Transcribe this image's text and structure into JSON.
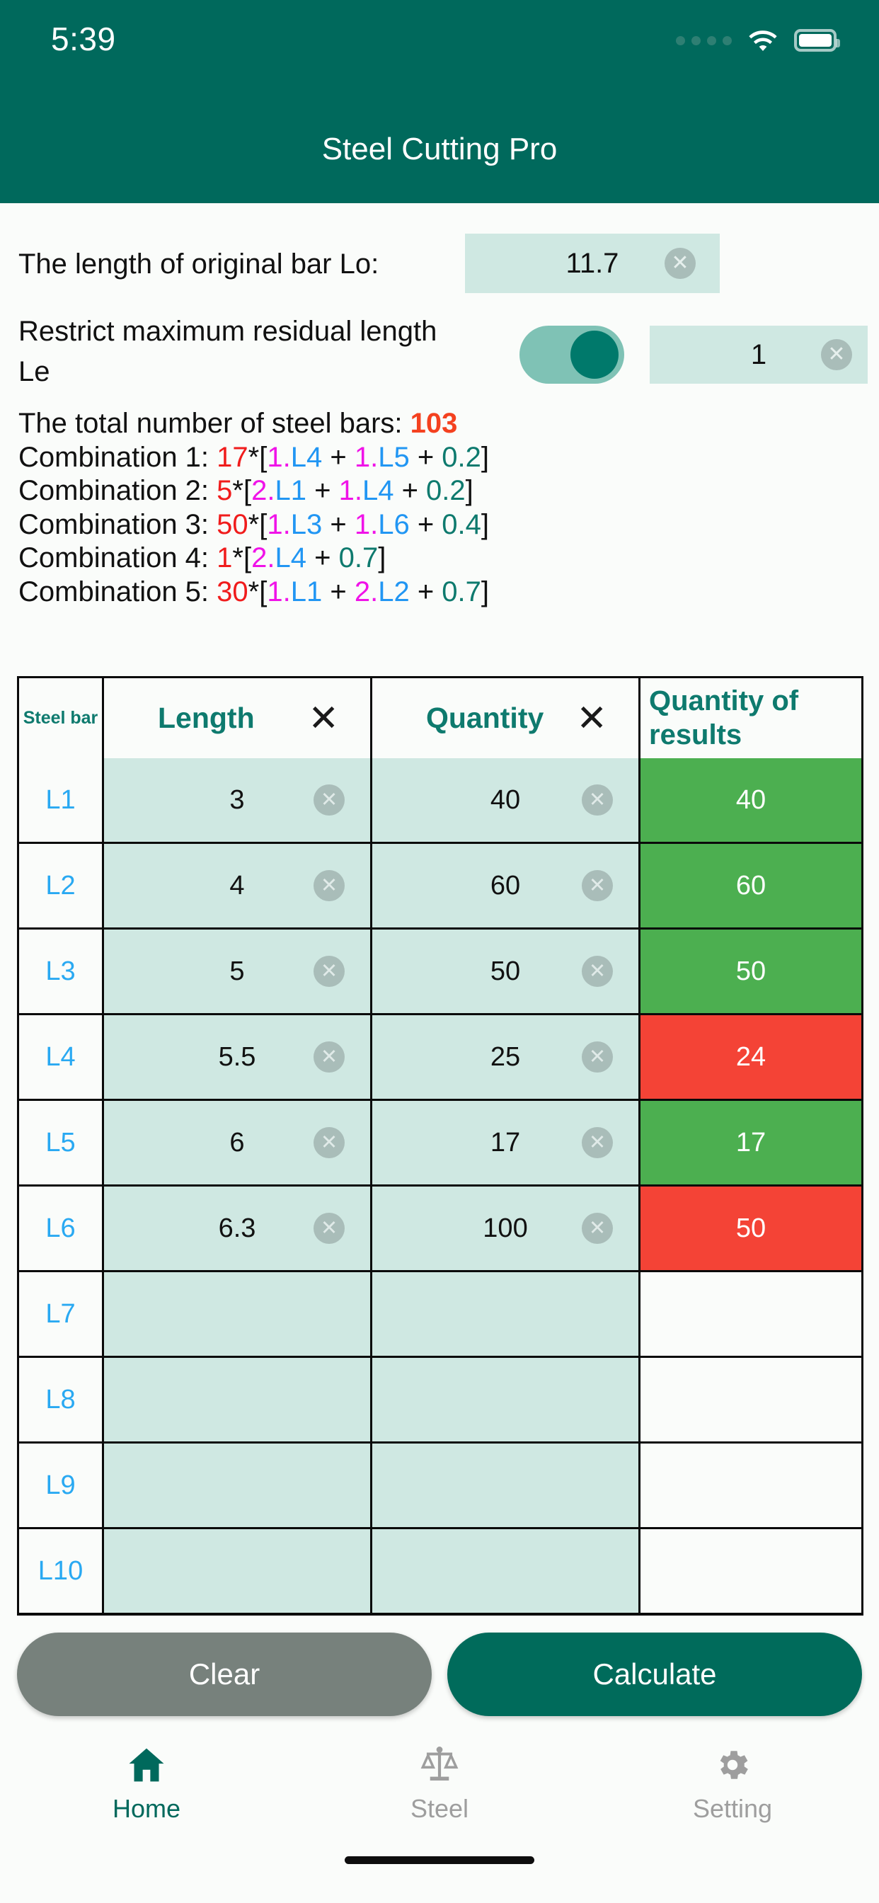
{
  "status_bar": {
    "time": "5:39",
    "signal_icon": "signal-dots-icon",
    "wifi_icon": "wifi-icon",
    "battery_icon": "battery-icon"
  },
  "app_bar": {
    "title": "Steel Cutting Pro",
    "background_color": "#00695C"
  },
  "settings": {
    "lo_label": "The length of original bar Lo:",
    "lo_value": "11.7",
    "lo_clear_icon": "clear-circle-icon",
    "le_label": "Restrict maximum residual length Le",
    "le_toggle_on": "true",
    "le_value": "1",
    "le_clear_icon": "clear-circle-icon"
  },
  "results": {
    "total_label": "The total number of steel bars: ",
    "total_value": "103",
    "combinations": [
      {
        "label": "Combination 1: ",
        "count": "17",
        "star": "*",
        "open": "[",
        "terms": [
          {
            "coef": "1",
            "dot": ".",
            "bar": "L4"
          },
          {
            "coef": "1",
            "dot": ".",
            "bar": "L5"
          }
        ],
        "residual": "0.2",
        "close": "]"
      },
      {
        "label": "Combination 2: ",
        "count": "5",
        "star": "*",
        "open": "[",
        "terms": [
          {
            "coef": "2",
            "dot": ".",
            "bar": "L1"
          },
          {
            "coef": "1",
            "dot": ".",
            "bar": "L4"
          }
        ],
        "residual": "0.2",
        "close": "]"
      },
      {
        "label": "Combination 3: ",
        "count": "50",
        "star": "*",
        "open": "[",
        "terms": [
          {
            "coef": "1",
            "dot": ".",
            "bar": "L3"
          },
          {
            "coef": "1",
            "dot": ".",
            "bar": "L6"
          }
        ],
        "residual": "0.4",
        "close": "]"
      },
      {
        "label": "Combination 4: ",
        "count": "1",
        "star": "*",
        "open": "[",
        "terms": [
          {
            "coef": "2",
            "dot": ".",
            "bar": "L4"
          }
        ],
        "residual": "0.7",
        "close": "]"
      },
      {
        "label": "Combination 5: ",
        "count": "30",
        "star": "*",
        "open": "[",
        "terms": [
          {
            "coef": "1",
            "dot": ".",
            "bar": "L1"
          },
          {
            "coef": "2",
            "dot": ".",
            "bar": "L2"
          }
        ],
        "residual": "0.7",
        "close": "]"
      }
    ],
    "plus": "+",
    "colors": {
      "count": "#F01C1C",
      "coefficient": "#F013E8",
      "bar_label": "#2196F3",
      "residual": "#0E7A6E",
      "total": "#F4411F"
    }
  },
  "table": {
    "headers": {
      "bar": "Steel bar",
      "length": "Length",
      "length_clear_icon": "x-clear-column-icon",
      "quantity": "Quantity",
      "quantity_clear_icon": "x-clear-column-icon",
      "results": "Quantity of results"
    },
    "column_clear_label": "✕",
    "cell_clear_icon": "clear-circle-icon",
    "rows": [
      {
        "bar": "L1",
        "length": "3",
        "quantity": "40",
        "result": "40",
        "status": "ok"
      },
      {
        "bar": "L2",
        "length": "4",
        "quantity": "60",
        "result": "60",
        "status": "ok"
      },
      {
        "bar": "L3",
        "length": "5",
        "quantity": "50",
        "result": "50",
        "status": "ok"
      },
      {
        "bar": "L4",
        "length": "5.5",
        "quantity": "25",
        "result": "24",
        "status": "bad"
      },
      {
        "bar": "L5",
        "length": "6",
        "quantity": "17",
        "result": "17",
        "status": "ok"
      },
      {
        "bar": "L6",
        "length": "6.3",
        "quantity": "100",
        "result": "50",
        "status": "bad"
      },
      {
        "bar": "L7",
        "length": "",
        "quantity": "",
        "result": "",
        "status": "empty"
      },
      {
        "bar": "L8",
        "length": "",
        "quantity": "",
        "result": "",
        "status": "empty"
      },
      {
        "bar": "L9",
        "length": "",
        "quantity": "",
        "result": "",
        "status": "empty"
      },
      {
        "bar": "L10",
        "length": "",
        "quantity": "",
        "result": "",
        "status": "empty"
      }
    ],
    "colors": {
      "ok": "#4CAF50",
      "bad": "#F44336",
      "input_cell": "#CFE8E2",
      "header_text": "#0E7A6E",
      "bar_text": "#29A9F2"
    }
  },
  "actions": {
    "clear_label": "Clear",
    "calculate_label": "Calculate",
    "clear_color": "#77817C",
    "calculate_color": "#006B5B"
  },
  "bottom_nav": {
    "items": [
      {
        "label": "Home",
        "icon": "home-icon",
        "active": "true"
      },
      {
        "label": "Steel",
        "icon": "scale-icon",
        "active": "false"
      },
      {
        "label": "Setting",
        "icon": "gear-icon",
        "active": "false"
      }
    ],
    "active_color": "#00695C",
    "idle_color": "#9E9E9E"
  }
}
